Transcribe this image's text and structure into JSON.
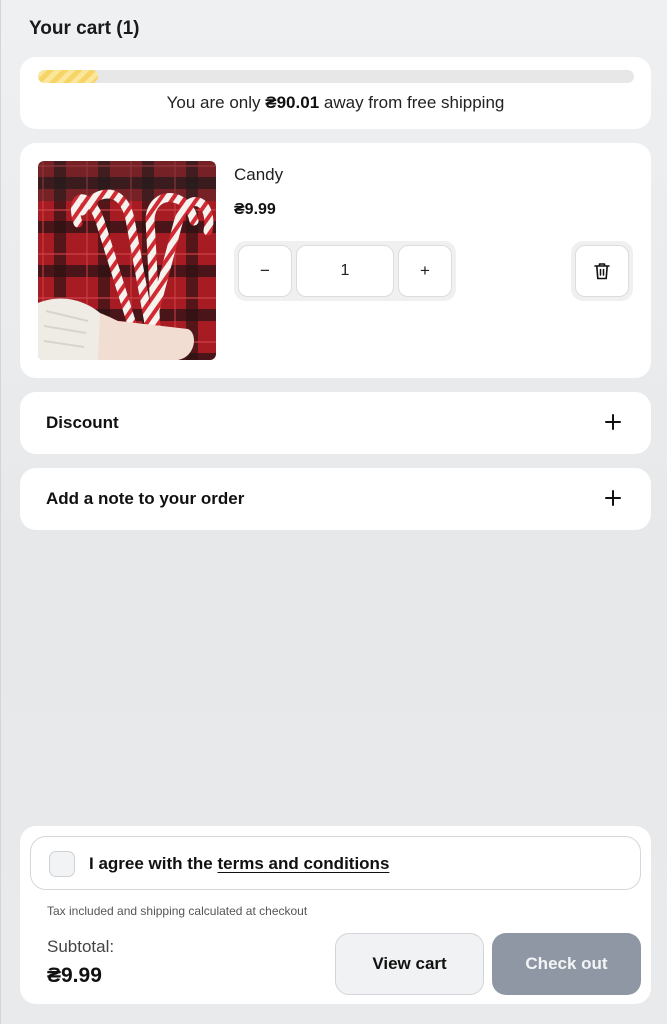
{
  "cart": {
    "title": "Your cart (1)"
  },
  "shipping": {
    "prefix": "You are only ",
    "amount": "₴90.01",
    "suffix": " away from free shipping",
    "progress_fraction": 0.1,
    "progress_color": "#f6d465"
  },
  "item": {
    "name": "Candy",
    "price": "₴9.99",
    "quantity": "1",
    "decrease_symbol": "−",
    "increase_symbol": "+",
    "image_icon": "candy-cane-photo",
    "remove_icon": "trash-icon"
  },
  "accordions": {
    "discount_label": "Discount",
    "note_label": "Add a note to your order"
  },
  "footer": {
    "agree_prefix": "I agree with the ",
    "terms_link": "terms and conditions",
    "tax_note": "Tax included and shipping calculated at checkout",
    "subtotal_label": "Subtotal:",
    "subtotal_value": "₴9.99",
    "view_cart_label": "View cart",
    "checkout_label": "Check out",
    "checkout_color": "#8f97a4"
  }
}
